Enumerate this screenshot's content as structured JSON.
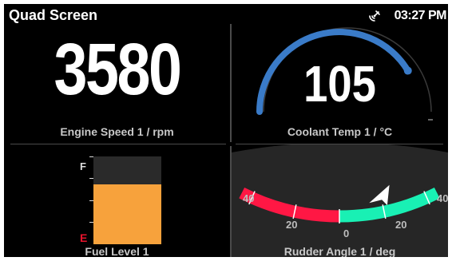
{
  "screen": {
    "title": "Quad Screen",
    "status_icon": "satellite-icon",
    "time": "03:27 PM"
  },
  "engine_speed": {
    "value": "3580",
    "label": "Engine Speed 1 / rpm"
  },
  "coolant_temp": {
    "value": "105",
    "label": "Coolant Temp 1 / °C",
    "gauge_fraction": 0.9,
    "arc_color": "#3a7bc8"
  },
  "fuel_level": {
    "label": "Fuel Level 1",
    "full_mark": "F",
    "empty_mark": "E",
    "fill_fraction": 0.68,
    "fill_color": "#f7a23c"
  },
  "rudder_angle": {
    "label": "Rudder Angle 1 / deg",
    "tick_labels": [
      "40",
      "20",
      "0",
      "20",
      "40"
    ],
    "value_deg": 20,
    "port_color": "#ff1744",
    "starboard_color": "#19f0b4"
  }
}
